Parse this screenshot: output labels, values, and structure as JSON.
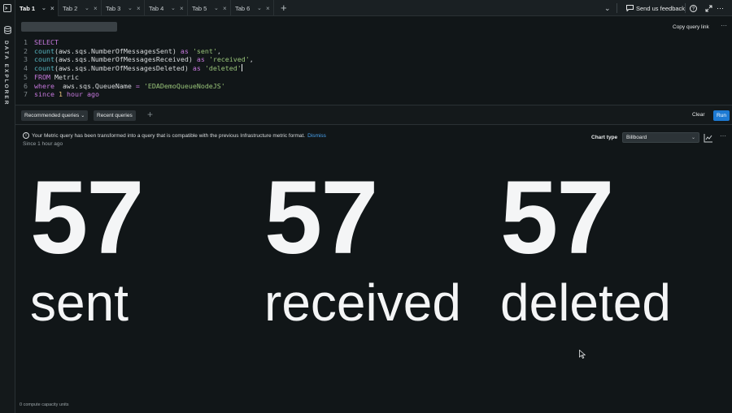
{
  "rail": {
    "label": "DATA EXPLORER",
    "icons": [
      "terminal-icon",
      "database-icon"
    ]
  },
  "tabs": [
    {
      "label": "Tab 1",
      "active": true
    },
    {
      "label": "Tab 2",
      "active": false
    },
    {
      "label": "Tab 3",
      "active": false
    },
    {
      "label": "Tab 4",
      "active": false
    },
    {
      "label": "Tab 5",
      "active": false
    },
    {
      "label": "Tab 6",
      "active": false
    }
  ],
  "header": {
    "feedback_label": "Send us feedback"
  },
  "editor": {
    "copy_link_label": "Copy query link",
    "lines": [
      {
        "n": "1",
        "parts": [
          {
            "t": "SELECT",
            "c": "kw"
          }
        ]
      },
      {
        "n": "2",
        "parts": [
          {
            "t": "count",
            "c": "fn"
          },
          {
            "t": "(aws.sqs.NumberOfMessagesSent) ",
            "c": "id"
          },
          {
            "t": "as",
            "c": "kw"
          },
          {
            "t": " 'sent'",
            "c": "str"
          },
          {
            "t": ",",
            "c": "id"
          }
        ]
      },
      {
        "n": "3",
        "parts": [
          {
            "t": "count",
            "c": "fn"
          },
          {
            "t": "(aws.sqs.NumberOfMessagesReceived) ",
            "c": "id"
          },
          {
            "t": "as",
            "c": "kw"
          },
          {
            "t": " 'received'",
            "c": "str"
          },
          {
            "t": ",",
            "c": "id"
          }
        ]
      },
      {
        "n": "4",
        "parts": [
          {
            "t": "count",
            "c": "fn"
          },
          {
            "t": "(aws.sqs.NumberOfMessagesDeleted) ",
            "c": "id"
          },
          {
            "t": "as",
            "c": "kw"
          },
          {
            "t": " 'deleted'",
            "c": "str"
          }
        ]
      },
      {
        "n": "5",
        "parts": [
          {
            "t": "FROM",
            "c": "kw"
          },
          {
            "t": " Metric",
            "c": "id"
          }
        ]
      },
      {
        "n": "6",
        "parts": [
          {
            "t": "where",
            "c": "kw"
          },
          {
            "t": "  aws.sqs.QueueName ",
            "c": "id"
          },
          {
            "t": "=",
            "c": "kw"
          },
          {
            "t": " 'EDADemoQueueNodeJS'",
            "c": "str"
          }
        ]
      },
      {
        "n": "7",
        "parts": [
          {
            "t": "since",
            "c": "kw"
          },
          {
            "t": " 1",
            "c": "num"
          },
          {
            "t": " hour ago",
            "c": "kw"
          }
        ]
      }
    ]
  },
  "toolbar": {
    "recommended_label": "Recommended queries",
    "recent_label": "Recent queries",
    "clear_label": "Clear",
    "run_label": "Run"
  },
  "results": {
    "notice_text": "Your Metric query has been transformed into a query that is compatible with the previous Infrastructure metric format.",
    "dismiss_label": "Dismiss",
    "since_text": "Since 1 hour ago",
    "chart_type_label": "Chart type",
    "chart_type_value": "Billboard",
    "billboards": [
      {
        "value": "57",
        "label": "sent"
      },
      {
        "value": "57",
        "label": "received"
      },
      {
        "value": "57",
        "label": "deleted"
      }
    ]
  },
  "footer": {
    "text": "0 compute capacity units"
  },
  "colors": {
    "accent": "#1d7ad4",
    "background": "#111618",
    "link": "#4aa3f0"
  }
}
